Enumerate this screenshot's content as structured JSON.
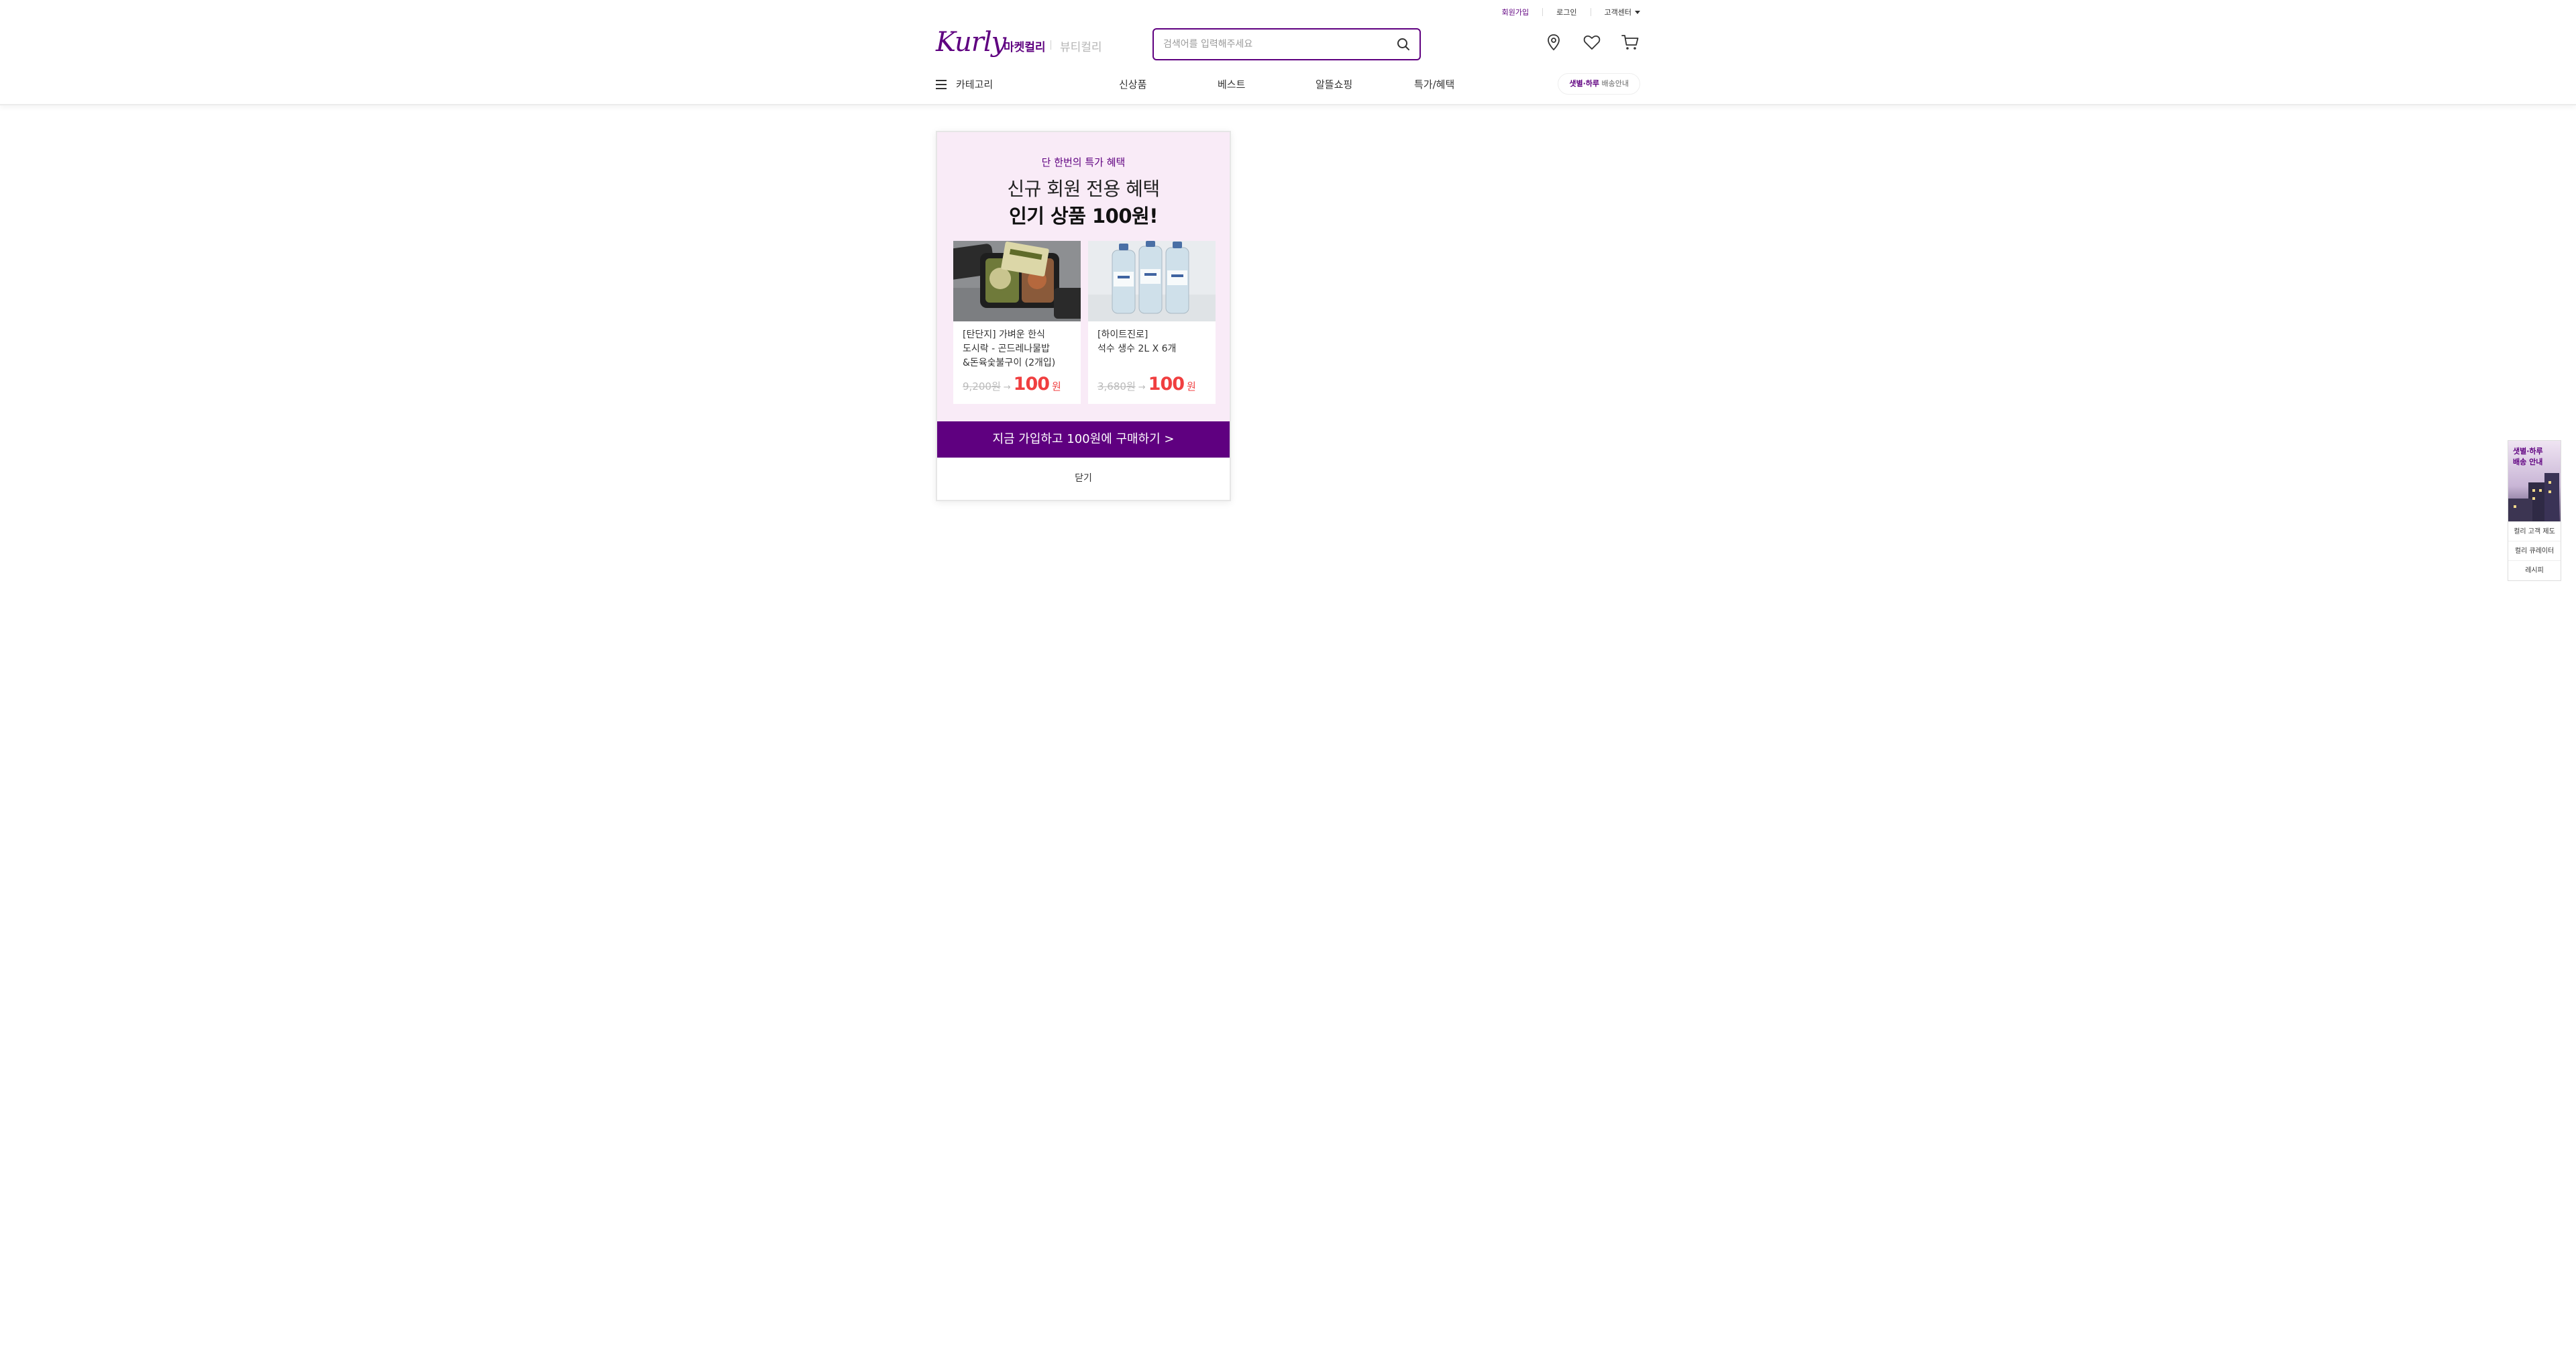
{
  "header": {
    "util": {
      "signup": "회원가입",
      "login": "로그인",
      "customer_center": "고객센터"
    },
    "logo": "Kurly",
    "services": {
      "market": "마켓컬리",
      "beauty": "뷰티컬리"
    },
    "search": {
      "placeholder": "검색어를 입력해주세요",
      "value": ""
    },
    "icons": [
      "location-icon",
      "heart-icon",
      "cart-icon"
    ]
  },
  "nav": {
    "category": "카테고리",
    "menus": [
      "신상품",
      "베스트",
      "알뜰쇼핑",
      "특가/혜택"
    ],
    "delivery": {
      "highlight": "샛별·하루",
      "rest": " 배송안내"
    }
  },
  "popup": {
    "eyebrow": "단 한번의 특가 혜택",
    "title_line1": "신규 회원 전용 혜택",
    "title_line2": "인기 상품 100원!",
    "products": [
      {
        "name": "[탄단지] 가벼운 한식\n도시락 - 곤드레나물밥\n&돈육숯불구이 (2개입)",
        "original_price": "9,200원",
        "arrow": "→",
        "sale_price": "100",
        "unit": "원"
      },
      {
        "name": "[하이트진로]\n석수 생수 2L X 6개",
        "original_price": "3,680원",
        "arrow": "→",
        "sale_price": "100",
        "unit": "원"
      }
    ],
    "cta": "지금 가입하고 100원에 구매하기 >",
    "close": "닫기"
  },
  "side": {
    "banner_text": "샛별·하루\n배송 안내",
    "links": [
      "컬리 고객 제도",
      "컬리 큐레이터",
      "레시피"
    ]
  },
  "colors": {
    "brand": "#5f0080",
    "popup_bg": "#f9ebf7",
    "sale": "#f03f40"
  }
}
